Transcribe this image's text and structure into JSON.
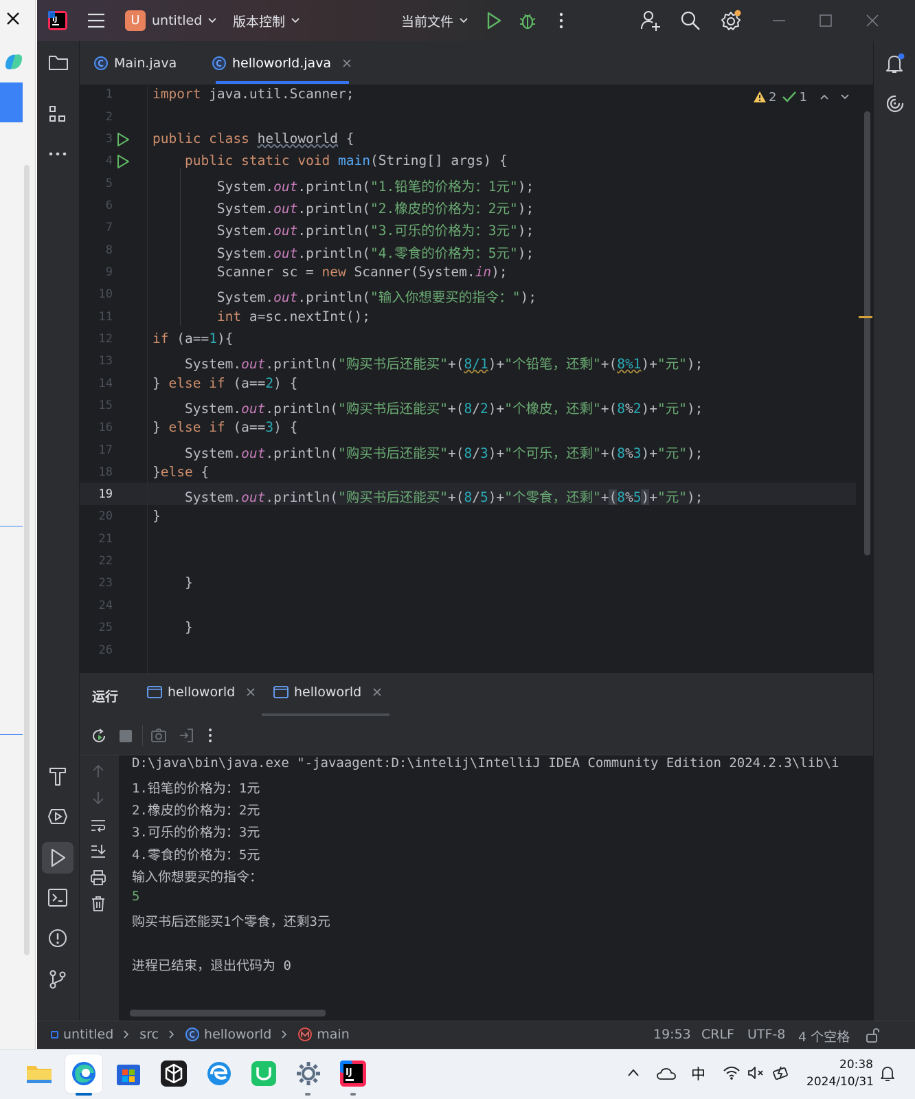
{
  "titlebar": {
    "project_badge": "U",
    "project_name": "untitled",
    "vcs_label": "版本控制",
    "run_config": "当前文件"
  },
  "tabs": [
    {
      "label": "Main.java"
    },
    {
      "label": "helloworld.java"
    }
  ],
  "inspection": {
    "warnings": "2",
    "ok": "1"
  },
  "line_numbers": [
    "1",
    "2",
    "3",
    "4",
    "5",
    "6",
    "7",
    "8",
    "9",
    "10",
    "11",
    "12",
    "13",
    "14",
    "15",
    "16",
    "17",
    "18",
    "19",
    "20",
    "21",
    "22",
    "23",
    "24",
    "25",
    "26"
  ],
  "run_panel": {
    "title": "运行",
    "tabs": [
      {
        "label": "helloworld"
      },
      {
        "label": "helloworld"
      }
    ],
    "output": [
      "D:\\java\\bin\\java.exe \"-javaagent:D:\\intelij\\IntelliJ IDEA Community Edition 2024.2.3\\lib\\i",
      "1.铅笔的价格为：1元",
      "2.橡皮的价格为：2元",
      "3.可乐的价格为：3元",
      "4.零食的价格为：5元",
      "输入你想要买的指令：",
      "5",
      "购买书后还能买1个零食，还剩3元",
      "",
      "进程已结束，退出代码为 0"
    ]
  },
  "statusbar": {
    "crumb_project": "untitled",
    "crumb_src": "src",
    "crumb_class": "helloworld",
    "crumb_method": "main",
    "position": "19:53",
    "line_sep": "CRLF",
    "encoding": "UTF-8",
    "indent": "4 个空格"
  },
  "taskbar": {
    "ime": "中",
    "time": "20:38",
    "date": "2024/10/31"
  },
  "colors": {
    "accent": "#3574f0",
    "run_green": "#5fb865",
    "warning": "#f2c55c"
  }
}
